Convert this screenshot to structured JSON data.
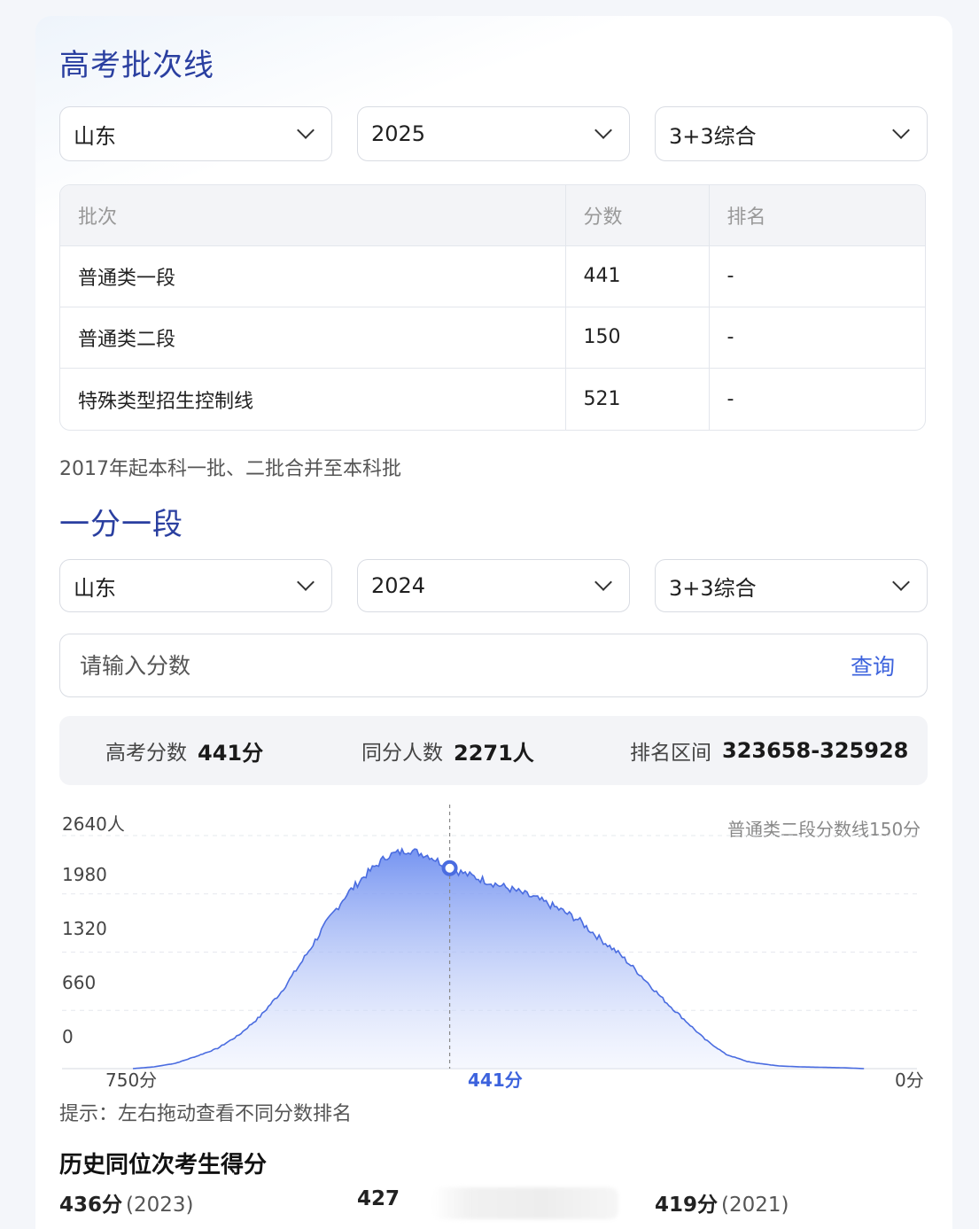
{
  "batch_section": {
    "title": "高考批次线",
    "selects": [
      {
        "value": "山东"
      },
      {
        "value": "2025"
      },
      {
        "value": "3+3综合"
      }
    ],
    "table": {
      "headers": [
        "批次",
        "分数",
        "排名"
      ],
      "rows": [
        [
          "普通类一段",
          "441",
          "-"
        ],
        [
          "普通类二段",
          "150",
          "-"
        ],
        [
          "特殊类型招生控制线",
          "521",
          "-"
        ]
      ]
    },
    "note": "2017年起本科一批、二批合并至本科批"
  },
  "score_section": {
    "title": "一分一段",
    "selects": [
      {
        "value": "山东"
      },
      {
        "value": "2024"
      },
      {
        "value": "3+3综合"
      }
    ],
    "input_placeholder": "请输入分数",
    "query_label": "查询",
    "stats": [
      {
        "label": "高考分数",
        "value": "441分"
      },
      {
        "label": "同分人数",
        "value": "2271人"
      },
      {
        "label": "排名区间",
        "value": "323658-325928"
      }
    ],
    "hint": "提示：左右拖动查看不同分数排名"
  },
  "chart_data": {
    "type": "area",
    "y_ticks": [
      "2640人",
      "1980",
      "1320",
      "660",
      "0"
    ],
    "ylim": [
      0,
      2640
    ],
    "x_tick_labels": [
      "750分",
      "441分",
      "0分"
    ],
    "x_range": [
      750,
      0
    ],
    "annotation": "普通类二段分数线150分",
    "selected_x": 441,
    "selected_y": 2271,
    "grid": true,
    "accent_color": "#4a6ce0",
    "series_points": [
      [
        740,
        0
      ],
      [
        720,
        20
      ],
      [
        700,
        60
      ],
      [
        680,
        140
      ],
      [
        660,
        230
      ],
      [
        640,
        380
      ],
      [
        620,
        590
      ],
      [
        600,
        870
      ],
      [
        580,
        1220
      ],
      [
        560,
        1600
      ],
      [
        540,
        1950
      ],
      [
        520,
        2200
      ],
      [
        500,
        2410
      ],
      [
        480,
        2480
      ],
      [
        460,
        2410
      ],
      [
        441,
        2271
      ],
      [
        420,
        2180
      ],
      [
        400,
        2100
      ],
      [
        380,
        2020
      ],
      [
        360,
        1930
      ],
      [
        340,
        1820
      ],
      [
        320,
        1690
      ],
      [
        300,
        1480
      ],
      [
        280,
        1290
      ],
      [
        260,
        1050
      ],
      [
        240,
        790
      ],
      [
        220,
        560
      ],
      [
        200,
        330
      ],
      [
        180,
        160
      ],
      [
        160,
        80
      ],
      [
        150,
        60
      ],
      [
        130,
        30
      ],
      [
        110,
        20
      ],
      [
        90,
        15
      ],
      [
        70,
        10
      ],
      [
        50,
        0
      ]
    ]
  },
  "history_section": {
    "title": "历史同位次考生得分",
    "items": [
      {
        "score": "436分",
        "year": "(2023)"
      },
      {
        "score": "427",
        "year": ""
      },
      {
        "score": "419分",
        "year": "(2021)"
      }
    ]
  }
}
